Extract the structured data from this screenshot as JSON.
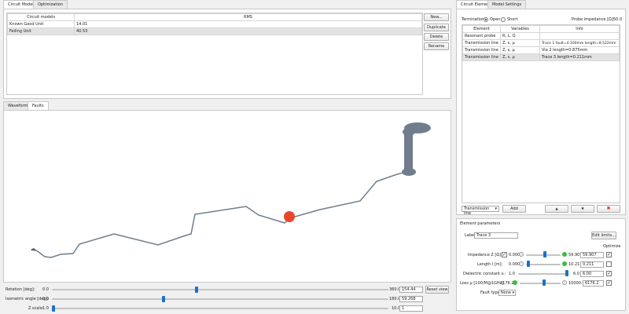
{
  "left_tabs": [
    "Circuit Models",
    "Optimization"
  ],
  "models_table": {
    "headers": [
      "Circuit models",
      "RMS"
    ],
    "rows": [
      [
        "Known Good Unit",
        "14.01"
      ],
      [
        "Failing Unit",
        "40.53"
      ]
    ]
  },
  "model_buttons": [
    "New...",
    "Duplicate",
    "Delete",
    "Rename"
  ],
  "view_tabs": [
    "Waveform",
    "Faults"
  ],
  "controls": {
    "rotation": {
      "label": "Rotation [deg]:",
      "min": "0.0",
      "max": "360.0",
      "value": "154.44",
      "fraction": 0.43
    },
    "isometric": {
      "label": "Isometric angle [deg]:",
      "min": "0.0",
      "max": "180.0",
      "value": "59.268",
      "fraction": 0.33
    },
    "zscale": {
      "label": "Z scale:",
      "min": "1.0",
      "max": "10.0",
      "value": "1",
      "fraction": 0.0
    },
    "reset_label": "Reset view"
  },
  "right_tabs": [
    "Circuit Elements",
    "Model Settings"
  ],
  "termination": {
    "label": "Termination:",
    "open": "Open",
    "short": "Short",
    "probe_label": "Probe impedance [Ω]:",
    "probe_value": "50.0"
  },
  "elements_table": {
    "headers": [
      "Element",
      "Variables",
      "Info"
    ],
    "rows": [
      [
        "Resonant probe",
        "R, L, Q",
        ""
      ],
      [
        "Transmission line",
        "Z, ε, μ",
        "Trace 1 fault=4.100mm length=8.522mm"
      ],
      [
        "Transmission line",
        "Z, ε, μ",
        "Via 2 length=0.875mm"
      ],
      [
        "Transmission line",
        "Z, ε, μ",
        "Trace 3 length=0.211mm"
      ]
    ]
  },
  "element_toolbar": {
    "select": "Transmission line",
    "add": "Add",
    "up": "▲",
    "down": "▼",
    "delete": "✖"
  },
  "params": {
    "title": "Element parameters",
    "label_caption": "Label:",
    "label_value": "Trace 3",
    "edit_limits": "Edit limits...",
    "optimize": "Optimize",
    "impedance": {
      "label": "Impedance Z [Ω]:",
      "min": "0.000",
      "max": "59.907",
      "value": "59.907",
      "fraction": 0.55
    },
    "length": {
      "label": "Length l [m]:",
      "min": "0.000",
      "max": "10.211",
      "value": "0.211",
      "fraction": 0.02
    },
    "dielectric": {
      "label": "Dielectric constant εᵣ:",
      "min": "1.0",
      "max": "6.0",
      "value": "6.00",
      "fraction": 1.0
    },
    "loss": {
      "label": "Loss μ [100/M@1GHz]:",
      "min": "1176.2",
      "max": "10000.0",
      "value": "6176.2",
      "fraction": 0.6
    },
    "fault_type_label": "Fault type:",
    "fault_type_value": "None"
  },
  "colors": {
    "trace": "#6f7d8c",
    "fault": "#e8472a",
    "probe": "#6f7d8c",
    "accent": "#1a73c8"
  }
}
